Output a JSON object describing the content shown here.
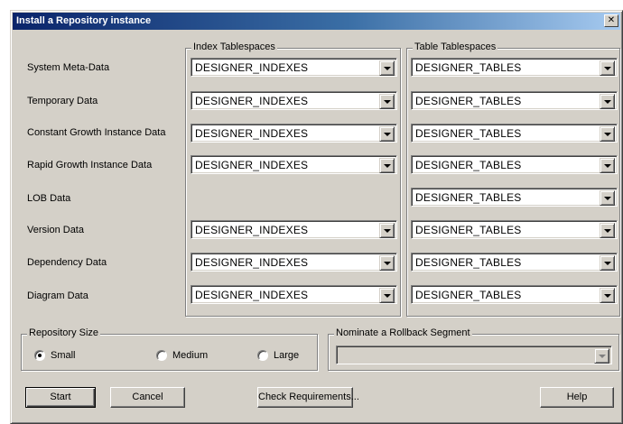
{
  "dialog": {
    "title": "Install a Repository instance",
    "close_symbol": "✕"
  },
  "index_group": {
    "title": "Index Tablespaces"
  },
  "table_group": {
    "title": "Table Tablespaces"
  },
  "rows": [
    {
      "label": "System Meta-Data",
      "index": "DESIGNER_INDEXES",
      "table": "DESIGNER_TABLES"
    },
    {
      "label": "Temporary Data",
      "index": "DESIGNER_INDEXES",
      "table": "DESIGNER_TABLES"
    },
    {
      "label": "Constant Growth Instance Data",
      "index": "DESIGNER_INDEXES",
      "table": "DESIGNER_TABLES"
    },
    {
      "label": "Rapid Growth Instance Data",
      "index": "DESIGNER_INDEXES",
      "table": "DESIGNER_TABLES"
    },
    {
      "label": "LOB Data",
      "index": null,
      "table": "DESIGNER_TABLES"
    },
    {
      "label": "Version Data",
      "index": "DESIGNER_INDEXES",
      "table": "DESIGNER_TABLES"
    },
    {
      "label": "Dependency Data",
      "index": "DESIGNER_INDEXES",
      "table": "DESIGNER_TABLES"
    },
    {
      "label": "Diagram Data",
      "index": "DESIGNER_INDEXES",
      "table": "DESIGNER_TABLES"
    }
  ],
  "repository_size": {
    "title": "Repository Size",
    "options": [
      {
        "label": "Small",
        "checked": true
      },
      {
        "label": "Medium",
        "checked": false
      },
      {
        "label": "Large",
        "checked": false
      }
    ]
  },
  "rollback": {
    "title": "Nominate a Rollback Segment",
    "value": ""
  },
  "buttons": {
    "start": "Start",
    "cancel": "Cancel",
    "check": "Check Requirements...",
    "help": "Help"
  }
}
